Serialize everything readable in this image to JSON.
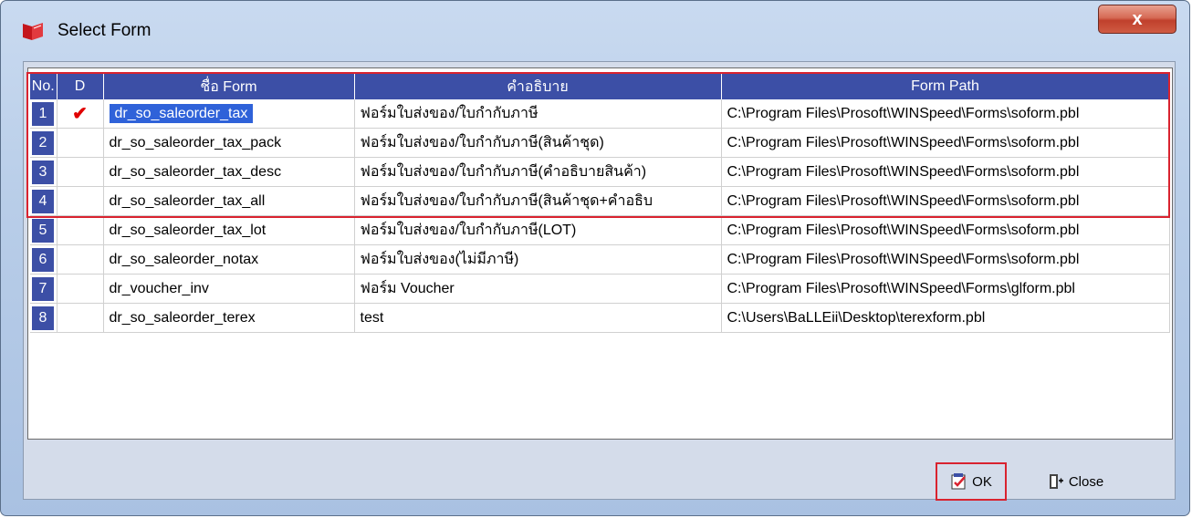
{
  "window": {
    "title": "Select Form",
    "close_label": "x"
  },
  "table": {
    "columns": [
      "No.",
      "D",
      "ชื่อ Form",
      "คำอธิบาย",
      "Form Path"
    ],
    "rows": [
      {
        "no": "1",
        "d": "✔",
        "name": "dr_so_saleorder_tax",
        "desc": "ฟอร์มใบส่งของ/ใบกำกับภาษี",
        "path": "C:\\Program Files\\Prosoft\\WINSpeed\\Forms\\soform.pbl"
      },
      {
        "no": "2",
        "d": "",
        "name": "dr_so_saleorder_tax_pack",
        "desc": "ฟอร์มใบส่งของ/ใบกำกับภาษี(สินค้าชุด)",
        "path": "C:\\Program Files\\Prosoft\\WINSpeed\\Forms\\soform.pbl"
      },
      {
        "no": "3",
        "d": "",
        "name": "dr_so_saleorder_tax_desc",
        "desc": "ฟอร์มใบส่งของ/ใบกำกับภาษี(คำอธิบายสินค้า)",
        "path": "C:\\Program Files\\Prosoft\\WINSpeed\\Forms\\soform.pbl"
      },
      {
        "no": "4",
        "d": "",
        "name": "dr_so_saleorder_tax_all",
        "desc": "ฟอร์มใบส่งของ/ใบกำกับภาษี(สินค้าชุด+คำอธิบ",
        "path": "C:\\Program Files\\Prosoft\\WINSpeed\\Forms\\soform.pbl"
      },
      {
        "no": "5",
        "d": "",
        "name": "dr_so_saleorder_tax_lot",
        "desc": "ฟอร์มใบส่งของ/ใบกำกับภาษี(LOT)",
        "path": "C:\\Program Files\\Prosoft\\WINSpeed\\Forms\\soform.pbl"
      },
      {
        "no": "6",
        "d": "",
        "name": "dr_so_saleorder_notax",
        "desc": "ฟอร์มใบส่งของ(ไม่มีภาษี)",
        "path": "C:\\Program Files\\Prosoft\\WINSpeed\\Forms\\soform.pbl"
      },
      {
        "no": "7",
        "d": "",
        "name": "dr_voucher_inv",
        "desc": "ฟอร์ม Voucher",
        "path": "C:\\Program Files\\Prosoft\\WINSpeed\\Forms\\glform.pbl"
      },
      {
        "no": "8",
        "d": "",
        "name": "dr_so_saleorder_terex",
        "desc": "test",
        "path": "C:\\Users\\BaLLEii\\Desktop\\terexform.pbl"
      }
    ]
  },
  "buttons": {
    "ok_label": "OK",
    "close_label": "Close"
  },
  "colors": {
    "header_bg": "#3c4fa6",
    "selection": "#2f62d9",
    "highlight": "#d9232f"
  }
}
